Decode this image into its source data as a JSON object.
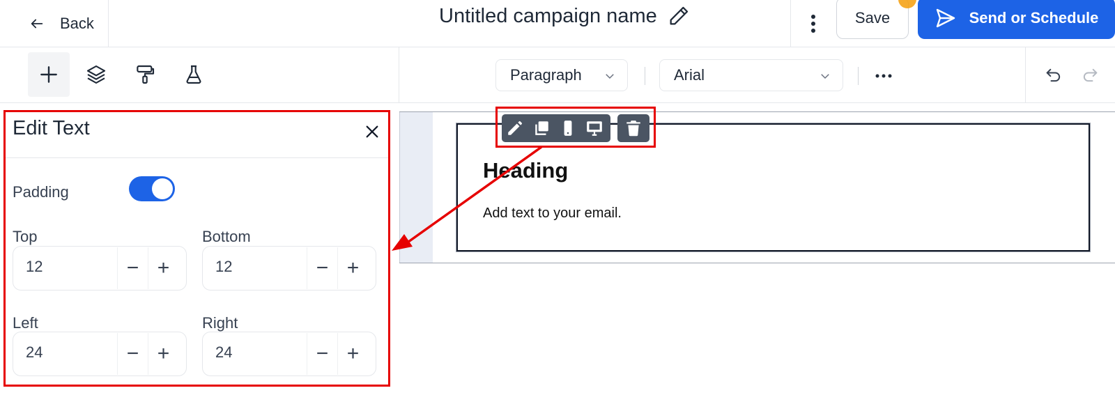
{
  "header": {
    "back_label": "Back",
    "campaign_title": "Untitled campaign name",
    "save_label": "Save",
    "send_label": "Send or Schedule",
    "brand_color": "#1d63e6"
  },
  "left_toolbar": {
    "tools": [
      "plus-icon",
      "layers-icon",
      "paint-roller-icon",
      "flask-icon"
    ]
  },
  "format_toolbar": {
    "block_type": "Paragraph",
    "font": "Arial"
  },
  "edit_panel": {
    "title": "Edit Text",
    "padding_label": "Padding",
    "padding_enabled": true,
    "fields": {
      "top": {
        "label": "Top",
        "value": "12"
      },
      "bottom": {
        "label": "Bottom",
        "value": "12"
      },
      "left": {
        "label": "Left",
        "value": "24"
      },
      "right": {
        "label": "Right",
        "value": "24"
      }
    },
    "minus_symbol": "−",
    "plus_symbol": "+"
  },
  "canvas": {
    "heading": "Heading",
    "body": "Add text to your email.",
    "block_actions": [
      "pencil-icon",
      "duplicate-icon",
      "mobile-icon",
      "desktop-icon",
      "trash-icon"
    ]
  },
  "annotation_color": "#e60000"
}
